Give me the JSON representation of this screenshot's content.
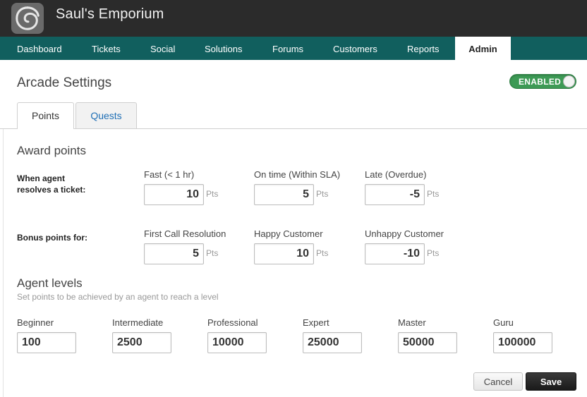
{
  "app": {
    "title": "Saul's Emporium",
    "logo_icon": "swirl-logo-icon"
  },
  "nav": {
    "items": [
      {
        "label": "Dashboard"
      },
      {
        "label": "Tickets"
      },
      {
        "label": "Social"
      },
      {
        "label": "Solutions"
      },
      {
        "label": "Forums"
      },
      {
        "label": "Customers"
      },
      {
        "label": "Reports"
      },
      {
        "label": "Admin",
        "active": true
      }
    ]
  },
  "page": {
    "title": "Arcade Settings"
  },
  "status_toggle": {
    "label": "ENABLED",
    "state": "on",
    "color": "#3d9a55"
  },
  "tabs": [
    {
      "label": "Points",
      "active": true
    },
    {
      "label": "Quests",
      "active": false
    }
  ],
  "award_points": {
    "title": "Award points",
    "unit": "Pts",
    "resolves": {
      "label": "When agent\nresolves a ticket:",
      "fields": [
        {
          "label": "Fast (< 1 hr)",
          "value": "10"
        },
        {
          "label": "On time (Within SLA)",
          "value": "5"
        },
        {
          "label": "Late (Overdue)",
          "value": "-5"
        }
      ]
    },
    "bonus": {
      "label": "Bonus points for:",
      "fields": [
        {
          "label": "First Call Resolution",
          "value": "5"
        },
        {
          "label": "Happy Customer",
          "value": "10"
        },
        {
          "label": "Unhappy Customer",
          "value": "-10"
        }
      ]
    }
  },
  "agent_levels": {
    "title": "Agent levels",
    "subtitle": "Set points to be achieved by an agent to reach a level",
    "levels": [
      {
        "label": "Beginner",
        "value": "100"
      },
      {
        "label": "Intermediate",
        "value": "2500"
      },
      {
        "label": "Professional",
        "value": "10000"
      },
      {
        "label": "Expert",
        "value": "25000"
      },
      {
        "label": "Master",
        "value": "50000"
      },
      {
        "label": "Guru",
        "value": "100000"
      }
    ]
  },
  "actions": {
    "cancel_label": "Cancel",
    "save_label": "Save"
  },
  "colors": {
    "nav_bg": "#115f5e",
    "topbar_bg": "#2b2b2b",
    "link": "#1f6fb5"
  }
}
